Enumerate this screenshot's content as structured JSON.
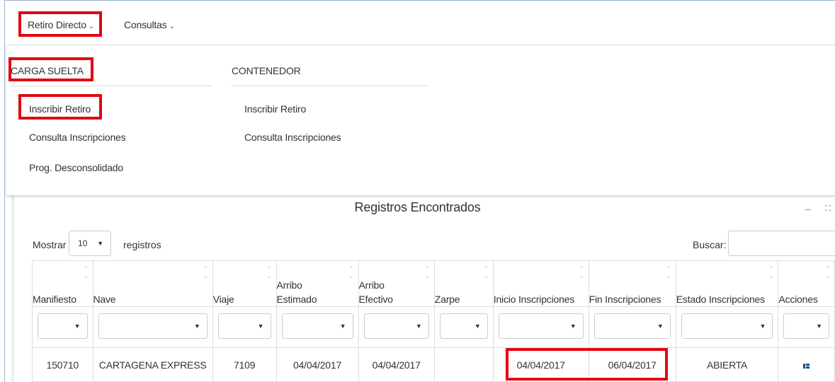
{
  "nav": {
    "retiro_directo": "Retiro Directo",
    "consultas": "Consultas"
  },
  "dropdown": {
    "carga_suelta": {
      "header": "CARGA SUELTA",
      "items": [
        "Inscribir Retiro",
        "Consulta Inscripciones",
        "Prog. Desconsolidado"
      ]
    },
    "contenedor": {
      "header": "CONTENEDOR",
      "items": [
        "Inscribir Retiro",
        "Consulta Inscripciones"
      ]
    }
  },
  "panel": {
    "title": "Registros Encontrados",
    "minimize": "–",
    "expand": "⛶"
  },
  "table_controls": {
    "show_label": "Mostrar",
    "page_length": "10",
    "records_label": "registros",
    "search_label": "Buscar:",
    "search_value": ""
  },
  "table": {
    "columns": [
      {
        "l1": "",
        "l2": "Manifiesto"
      },
      {
        "l1": "",
        "l2": "Nave"
      },
      {
        "l1": "",
        "l2": "Viaje"
      },
      {
        "l1": "Arribo",
        "l2": "Estimado"
      },
      {
        "l1": "Arribo",
        "l2": "Efectivo"
      },
      {
        "l1": "",
        "l2": "Zarpe"
      },
      {
        "l1": "",
        "l2": "Inicio Inscripciones"
      },
      {
        "l1": "",
        "l2": "Fin Inscripciones"
      },
      {
        "l1": "",
        "l2": "Estado Inscripciones"
      },
      {
        "l1": "",
        "l2": "Acciones"
      }
    ],
    "rows": [
      [
        "150710",
        "CARTAGENA EXPRESS",
        "7109",
        "04/04/2017",
        "04/04/2017",
        "",
        "04/04/2017",
        "06/04/2017",
        "ABIERTA",
        ""
      ]
    ]
  },
  "colors": {
    "highlight": "#e30613",
    "action_icon": "#1a4f8a"
  }
}
